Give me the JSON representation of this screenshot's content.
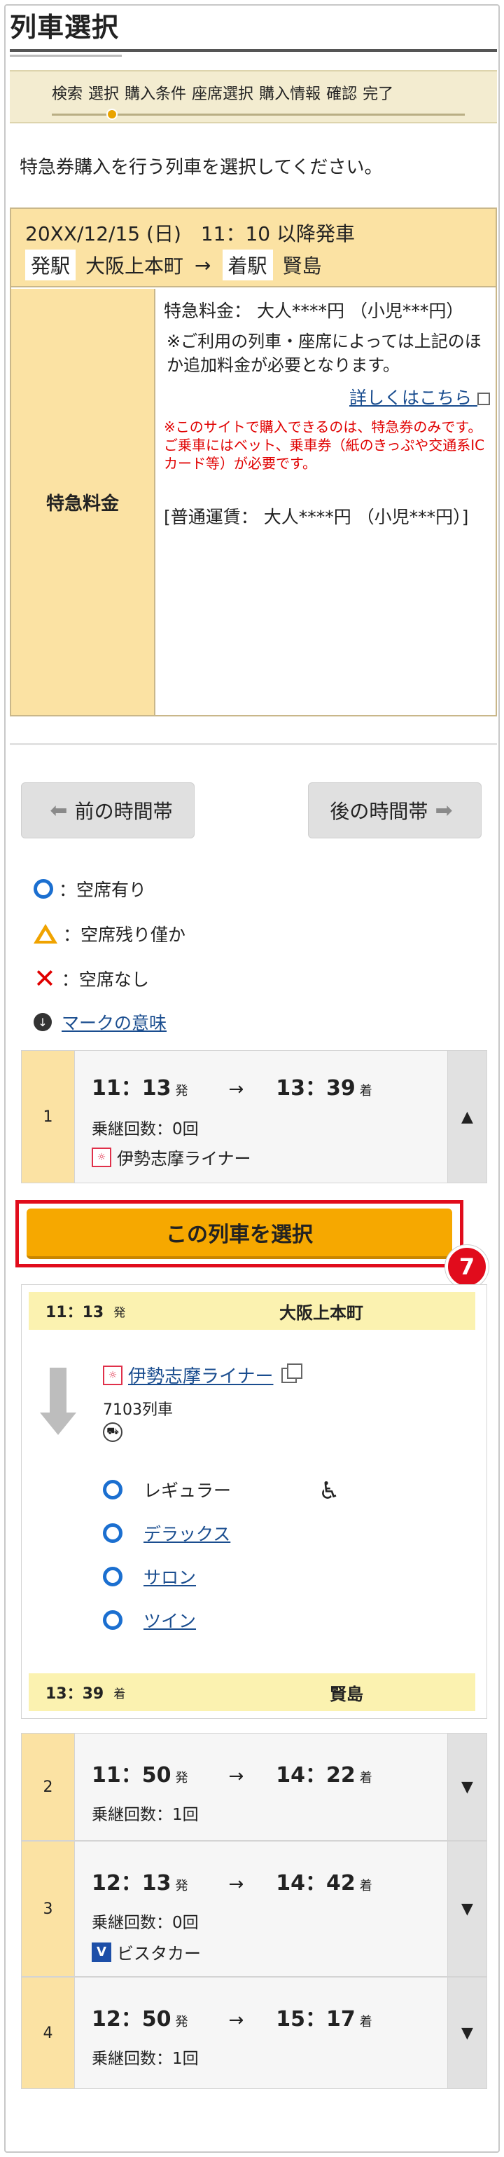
{
  "header": {
    "title": "列車選択"
  },
  "stepper": {
    "steps": [
      "検索",
      "選択",
      "購入条件",
      "座席選択",
      "購入情報",
      "確認",
      "完了"
    ],
    "current_index": 1
  },
  "instruction": "特急券購入を行う列車を選択してください。",
  "journey": {
    "date_time": "20XX/12/15 (日)　11：10 以降発車",
    "from_label": "発駅",
    "from_station": "大阪上本町",
    "arrow": "→",
    "to_label": "着駅",
    "to_station": "賢島"
  },
  "fee": {
    "label": "特急料金",
    "price_line": "特急料金：  大人****円 （小児***円）",
    "note": "※ご利用の列車・座席によっては上記のほか追加料金が必要となります。",
    "details_link": "詳しくはこちら",
    "red_note": "※このサイトで購入できるのは、特急券のみです。ご乗車にはベット、乗車券（紙のきっぷや交通系ICカード等）が必要です。",
    "fare_line": "[普通運賃：  大人****円 （小児***円）]"
  },
  "nav": {
    "prev": "前の時間帯",
    "next": "後の時間帯"
  },
  "legend": {
    "available": "：空席有り",
    "few": "：空席残り僅か",
    "none": "：空席なし",
    "mark_link": "マークの意味"
  },
  "trains": [
    {
      "num": "1",
      "dep": "11：13",
      "arr": "13：39",
      "dep_suffix": "発",
      "arr_suffix": "着",
      "transfer": "乗継回数：0回",
      "name": "伊勢志摩ライナー",
      "toggle": "▲"
    },
    {
      "num": "2",
      "dep": "11：50",
      "arr": "14：22",
      "dep_suffix": "発",
      "arr_suffix": "着",
      "transfer": "乗継回数：1回",
      "name": "",
      "toggle": "▼"
    },
    {
      "num": "3",
      "dep": "12：13",
      "arr": "14：42",
      "dep_suffix": "発",
      "arr_suffix": "着",
      "transfer": "乗継回数：0回",
      "name": "ビスタカー",
      "toggle": "▼"
    },
    {
      "num": "4",
      "dep": "12：50",
      "arr": "15：17",
      "dep_suffix": "発",
      "arr_suffix": "着",
      "transfer": "乗継回数：1回",
      "name": "",
      "toggle": "▼"
    }
  ],
  "select_button": "この列車を選択",
  "badge": "7",
  "detail": {
    "dep_time": "11：13",
    "dep_suffix": "発",
    "dep_station": "大阪上本町",
    "train_name": "伊勢志摩ライナー",
    "train_no": "7103列車",
    "seats": [
      "レギュラー",
      "デラックス",
      "サロン",
      "ツイン"
    ],
    "arr_time": "13：39",
    "arr_suffix": "着",
    "arr_station": "賢島"
  },
  "colors": {
    "accent_orange": "#f6a800",
    "highlight_red": "#e10c1c",
    "link_blue": "#1a4d8f",
    "header_yellow": "#fbe2a3"
  }
}
